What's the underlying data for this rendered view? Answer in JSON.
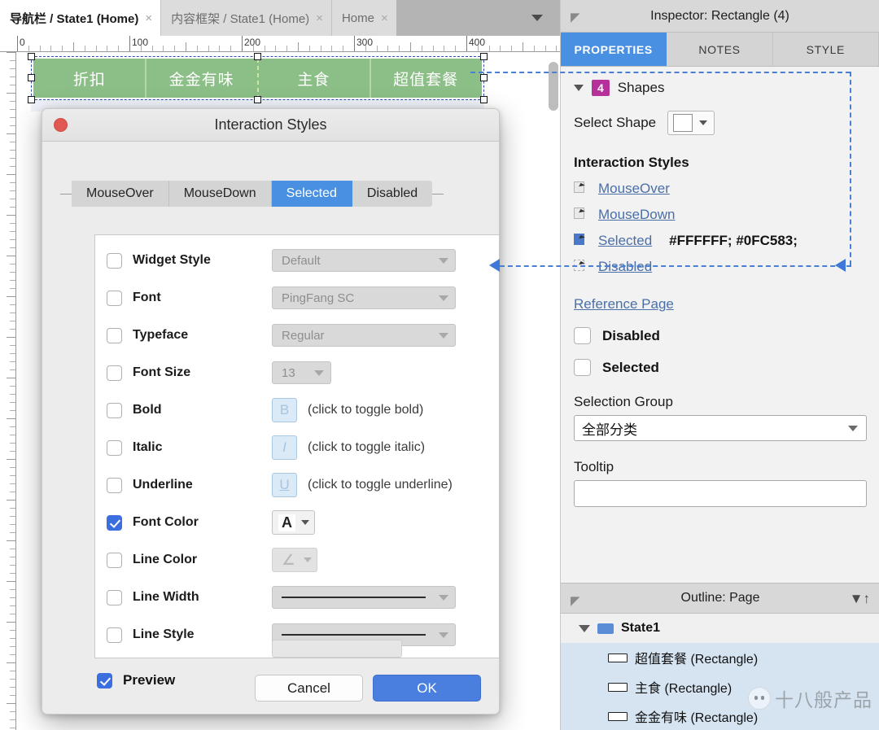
{
  "page_tabs": [
    {
      "label": "导航栏 / State1 (Home)",
      "close": "×",
      "active": true
    },
    {
      "label": "内容框架 / State1 (Home)",
      "close": "×",
      "active": false
    },
    {
      "label": "Home",
      "close": "×",
      "active": false
    }
  ],
  "ruler": {
    "h_labels": [
      "0",
      "100",
      "200",
      "300",
      "400"
    ],
    "h_positions": [
      0,
      100,
      200,
      300,
      400
    ]
  },
  "canvas": {
    "nav_widget": {
      "items": [
        "折扣",
        "金金有味",
        "主食",
        "超值套餐"
      ],
      "fill_color": "#8CBF87",
      "separator_color": "#B4D8AB",
      "text_color": "#FFFFFF"
    }
  },
  "dialog": {
    "title": "Interaction Styles",
    "close_label": "",
    "state_tabs": [
      {
        "label": "MouseOver",
        "selected": false
      },
      {
        "label": "MouseDown",
        "selected": false
      },
      {
        "label": "Selected",
        "selected": true
      },
      {
        "label": "Disabled",
        "selected": false
      }
    ],
    "options": [
      {
        "label": "Widget Style",
        "checked": false,
        "control": "dropdown",
        "value": "Default"
      },
      {
        "label": "Font",
        "checked": false,
        "control": "dropdown",
        "value": "PingFang SC"
      },
      {
        "label": "Typeface",
        "checked": false,
        "control": "dropdown",
        "value": "Regular"
      },
      {
        "label": "Font Size",
        "checked": false,
        "control": "dropdown-small",
        "value": "13"
      },
      {
        "label": "Bold",
        "checked": false,
        "control": "toggle",
        "glyph": "B",
        "hint": "(click to toggle bold)"
      },
      {
        "label": "Italic",
        "checked": false,
        "control": "toggle",
        "glyph": "I",
        "hint": "(click to toggle italic)"
      },
      {
        "label": "Underline",
        "checked": false,
        "control": "toggle",
        "glyph": "U",
        "hint": "(click to toggle underline)"
      },
      {
        "label": "Font Color",
        "checked": true,
        "control": "color",
        "glyph": "A"
      },
      {
        "label": "Line Color",
        "checked": false,
        "control": "color-dim",
        "glyph": "∠"
      },
      {
        "label": "Line Width",
        "checked": false,
        "control": "line"
      },
      {
        "label": "Line Style",
        "checked": false,
        "control": "line"
      }
    ],
    "preview": {
      "label": "Preview",
      "checked": true
    },
    "buttons": {
      "cancel": "Cancel",
      "ok": "OK"
    }
  },
  "inspector": {
    "header": "Inspector: Rectangle (4)",
    "tabs": [
      {
        "label": "PROPERTIES",
        "selected": true
      },
      {
        "label": "NOTES",
        "selected": false
      },
      {
        "label": "STYLE",
        "selected": false
      }
    ],
    "shapes": {
      "count": "4",
      "label": "Shapes"
    },
    "select_shape": {
      "label": "Select Shape"
    },
    "interaction_styles_header": "Interaction Styles",
    "interaction_styles": [
      {
        "label": "MouseOver",
        "value": ""
      },
      {
        "label": "MouseDown",
        "value": ""
      },
      {
        "label": "Selected",
        "value": "#FFFFFF; #0FC583;"
      },
      {
        "label": "Disabled",
        "value": ""
      }
    ],
    "reference_page": "Reference Page",
    "checkboxes": [
      {
        "label": "Disabled",
        "checked": false
      },
      {
        "label": "Selected",
        "checked": false
      }
    ],
    "selection_group": {
      "label": "Selection Group",
      "value": "全部分类"
    },
    "tooltip": {
      "label": "Tooltip",
      "value": ""
    }
  },
  "outline": {
    "header": "Outline: Page",
    "rows": [
      {
        "label": "State1",
        "type": "state",
        "expanded": true
      },
      {
        "label": "超值套餐 (Rectangle)",
        "type": "rect"
      },
      {
        "label": "主食 (Rectangle)",
        "type": "rect"
      },
      {
        "label": "金金有味 (Rectangle)",
        "type": "rect"
      }
    ]
  },
  "watermark": {
    "text": "十八般产品"
  },
  "colors": {
    "accent_blue": "#4A90E2",
    "green_fill": "#8CBF87",
    "badge_purple": "#B5309B",
    "ok_blue": "#4A7FE0"
  }
}
